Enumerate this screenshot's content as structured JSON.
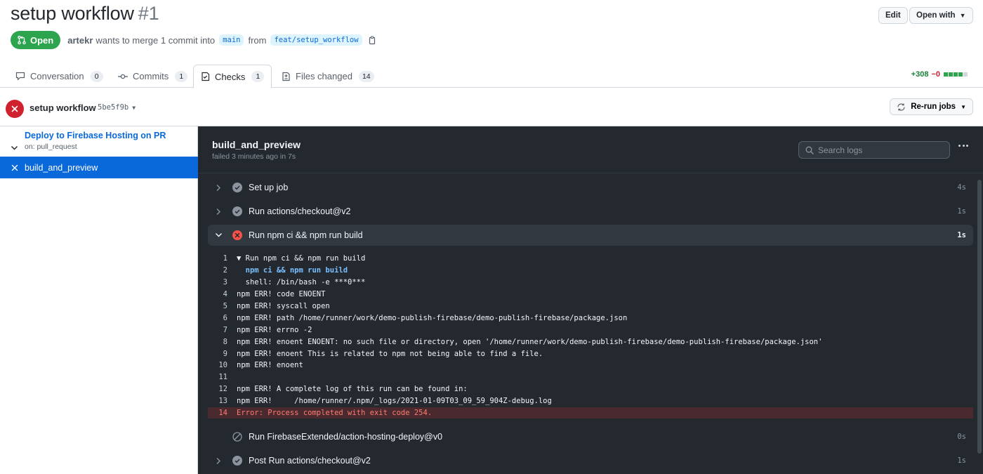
{
  "header": {
    "title": "setup workflow",
    "number": "#1",
    "edit_label": "Edit",
    "open_with_label": "Open with"
  },
  "state": {
    "badge": "Open",
    "author": "artekr",
    "merge_text": "wants to merge 1 commit into",
    "base_branch": "main",
    "from_text": "from",
    "head_branch": "feat/setup_workflow"
  },
  "tabs": [
    {
      "label": "Conversation",
      "count": "0"
    },
    {
      "label": "Commits",
      "count": "1"
    },
    {
      "label": "Checks",
      "count": "1"
    },
    {
      "label": "Files changed",
      "count": "14"
    }
  ],
  "diffstat": {
    "additions": "+308",
    "deletions": "−0"
  },
  "workflow": {
    "name": "setup workflow",
    "sha": "5be5f9b",
    "rerun_label": "Re-run jobs"
  },
  "sidebar": {
    "group_title": "Deploy to Firebase Hosting on PR",
    "group_trigger": "on: pull_request",
    "job": "build_and_preview"
  },
  "job": {
    "title": "build_and_preview",
    "subtitle": "failed 3 minutes ago in 7s",
    "search_placeholder": "Search logs"
  },
  "steps": [
    {
      "name": "Set up job",
      "time": "4s",
      "status": "success"
    },
    {
      "name": "Run actions/checkout@v2",
      "time": "1s",
      "status": "success"
    },
    {
      "name": "Run npm ci && npm run build",
      "time": "1s",
      "status": "failure"
    },
    {
      "name": "Run FirebaseExtended/action-hosting-deploy@v0",
      "time": "0s",
      "status": "skipped"
    },
    {
      "name": "Post Run actions/checkout@v2",
      "time": "1s",
      "status": "success"
    }
  ],
  "log_lines": [
    {
      "n": "1",
      "text": "▼ Run npm ci && npm run build"
    },
    {
      "n": "2",
      "text": "  npm ci && npm run build"
    },
    {
      "n": "3",
      "text": "  shell: /bin/bash -e ***0***"
    },
    {
      "n": "4",
      "text": "npm ERR! code ENOENT"
    },
    {
      "n": "5",
      "text": "npm ERR! syscall open"
    },
    {
      "n": "6",
      "text": "npm ERR! path /home/runner/work/demo-publish-firebase/demo-publish-firebase/package.json"
    },
    {
      "n": "7",
      "text": "npm ERR! errno -2"
    },
    {
      "n": "8",
      "text": "npm ERR! enoent ENOENT: no such file or directory, open '/home/runner/work/demo-publish-firebase/demo-publish-firebase/package.json'"
    },
    {
      "n": "9",
      "text": "npm ERR! enoent This is related to npm not being able to find a file."
    },
    {
      "n": "10",
      "text": "npm ERR! enoent"
    },
    {
      "n": "11",
      "text": ""
    },
    {
      "n": "12",
      "text": "npm ERR! A complete log of this run can be found in:"
    },
    {
      "n": "13",
      "text": "npm ERR!     /home/runner/.npm/_logs/2021-01-09T03_09_59_904Z-debug.log"
    },
    {
      "n": "14",
      "text": "Error: Process completed with exit code 254."
    }
  ]
}
